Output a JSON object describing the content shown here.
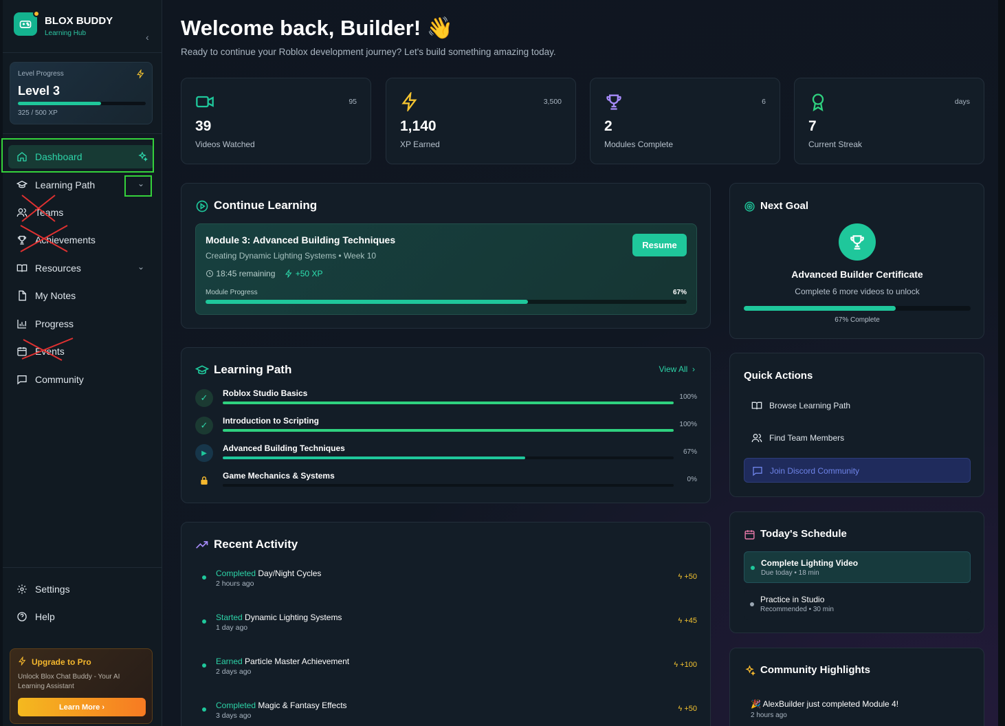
{
  "brand": {
    "name": "BLOX BUDDY",
    "subtitle": "Learning Hub"
  },
  "level": {
    "label": "Level Progress",
    "title": "Level 3",
    "xp_text": "325 / 500 XP",
    "progress": 0.65
  },
  "nav": [
    {
      "label": "Dashboard",
      "icon": "home-icon"
    },
    {
      "label": "Learning Path",
      "icon": "graduation-cap-icon"
    },
    {
      "label": "Teams",
      "icon": "users-icon"
    },
    {
      "label": "Achievements",
      "icon": "trophy-icon"
    },
    {
      "label": "Resources",
      "icon": "book-open-icon"
    },
    {
      "label": "My Notes",
      "icon": "file-icon"
    },
    {
      "label": "Progress",
      "icon": "bar-chart-icon"
    },
    {
      "label": "Events",
      "icon": "calendar-icon"
    },
    {
      "label": "Community",
      "icon": "message-square-icon"
    }
  ],
  "footer_nav": [
    {
      "label": "Settings",
      "icon": "gear-icon"
    },
    {
      "label": "Help",
      "icon": "help-circle-icon"
    }
  ],
  "upgrade": {
    "title": "Upgrade to Pro",
    "description": "Unlock Blox Chat Buddy - Your AI Learning Assistant",
    "button": "Learn More"
  },
  "welcome": {
    "title": "Welcome back, Builder!",
    "emoji": "👋",
    "subtitle": "Ready to continue your Roblox development journey? Let's build something amazing today."
  },
  "stats": [
    {
      "value": "39",
      "label": "Videos Watched",
      "top": "95",
      "icon": "video-icon"
    },
    {
      "value": "1,140",
      "label": "XP Earned",
      "top": "3,500",
      "icon": "bolt-icon"
    },
    {
      "value": "2",
      "label": "Modules Complete",
      "top": "6",
      "icon": "trophy-icon"
    },
    {
      "value": "7",
      "label": "Current Streak",
      "top": "days",
      "icon": "award-icon"
    }
  ],
  "continue": {
    "title": "Continue Learning",
    "module_title": "Module 3: Advanced Building Techniques",
    "module_sub": "Creating Dynamic Lighting Systems • Week 10",
    "remaining": "18:45 remaining",
    "xp": "+50 XP",
    "progress_label": "Module Progress",
    "progress_text": "67%",
    "progress": 0.67,
    "button": "Resume"
  },
  "learning_path": {
    "title": "Learning Path",
    "view_all": "View All",
    "items": [
      {
        "name": "Roblox Studio Basics",
        "pct_text": "100%",
        "progress": 1.0,
        "state": "done"
      },
      {
        "name": "Introduction to Scripting",
        "pct_text": "100%",
        "progress": 1.0,
        "state": "done"
      },
      {
        "name": "Advanced Building Techniques",
        "pct_text": "67%",
        "progress": 0.67,
        "state": "active"
      },
      {
        "name": "Game Mechanics & Systems",
        "pct_text": "0%",
        "progress": 0.0,
        "state": "locked"
      }
    ]
  },
  "activity": {
    "title": "Recent Activity",
    "items": [
      {
        "verb": "Completed",
        "text": "Day/Night Cycles",
        "time": "2 hours ago",
        "xp": "+50"
      },
      {
        "verb": "Started",
        "text": "Dynamic Lighting Systems",
        "time": "1 day ago",
        "xp": "+45"
      },
      {
        "verb": "Earned",
        "text": "Particle Master Achievement",
        "time": "2 days ago",
        "xp": "+100"
      },
      {
        "verb": "Completed",
        "text": "Magic & Fantasy Effects",
        "time": "3 days ago",
        "xp": "+50"
      }
    ]
  },
  "next_goal": {
    "title": "Next Goal",
    "goal": "Advanced Builder Certificate",
    "sub": "Complete 6 more videos to unlock",
    "pct_text": "67% Complete",
    "progress": 0.67
  },
  "quick_actions": {
    "title": "Quick Actions",
    "items": [
      {
        "label": "Browse Learning Path",
        "icon": "book-open-icon"
      },
      {
        "label": "Find Team Members",
        "icon": "users-icon"
      },
      {
        "label": "Join Discord Community",
        "icon": "message-square-icon"
      }
    ]
  },
  "schedule": {
    "title": "Today's Schedule",
    "items": [
      {
        "title": "Complete Lighting Video",
        "sub": "Due today • 18 min"
      },
      {
        "title": "Practice in Studio",
        "sub": "Recommended • 30 min"
      }
    ]
  },
  "community": {
    "title": "Community Highlights",
    "item": "AlexBuilder just completed Module 4!",
    "time": "2 hours ago"
  },
  "colors": {
    "accent": "#1fc79b",
    "gold": "#f5b82e",
    "purple": "#a78bfa",
    "discord": "#6e83e8"
  }
}
